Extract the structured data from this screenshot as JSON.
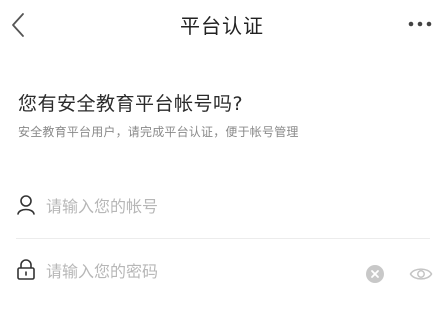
{
  "nav": {
    "title": "平台认证",
    "back_icon": "chevron-left-icon",
    "more_icon": "more-horizontal-icon"
  },
  "header": {
    "headline": "您有安全教育平台帐号吗?",
    "subline": "安全教育平台用户，请完成平台认证，便于帐号管理"
  },
  "form": {
    "account": {
      "placeholder": "请输入您的帐号",
      "value": "",
      "icon": "user-icon"
    },
    "password": {
      "placeholder": "请输入您的密码",
      "value": "",
      "icon": "lock-icon",
      "clear_icon": "clear-icon",
      "visibility_icon": "eye-icon"
    }
  },
  "colors": {
    "text_primary": "#222222",
    "text_secondary": "#8a8a8a",
    "placeholder": "#b7b7b7",
    "divider": "#ececec"
  }
}
